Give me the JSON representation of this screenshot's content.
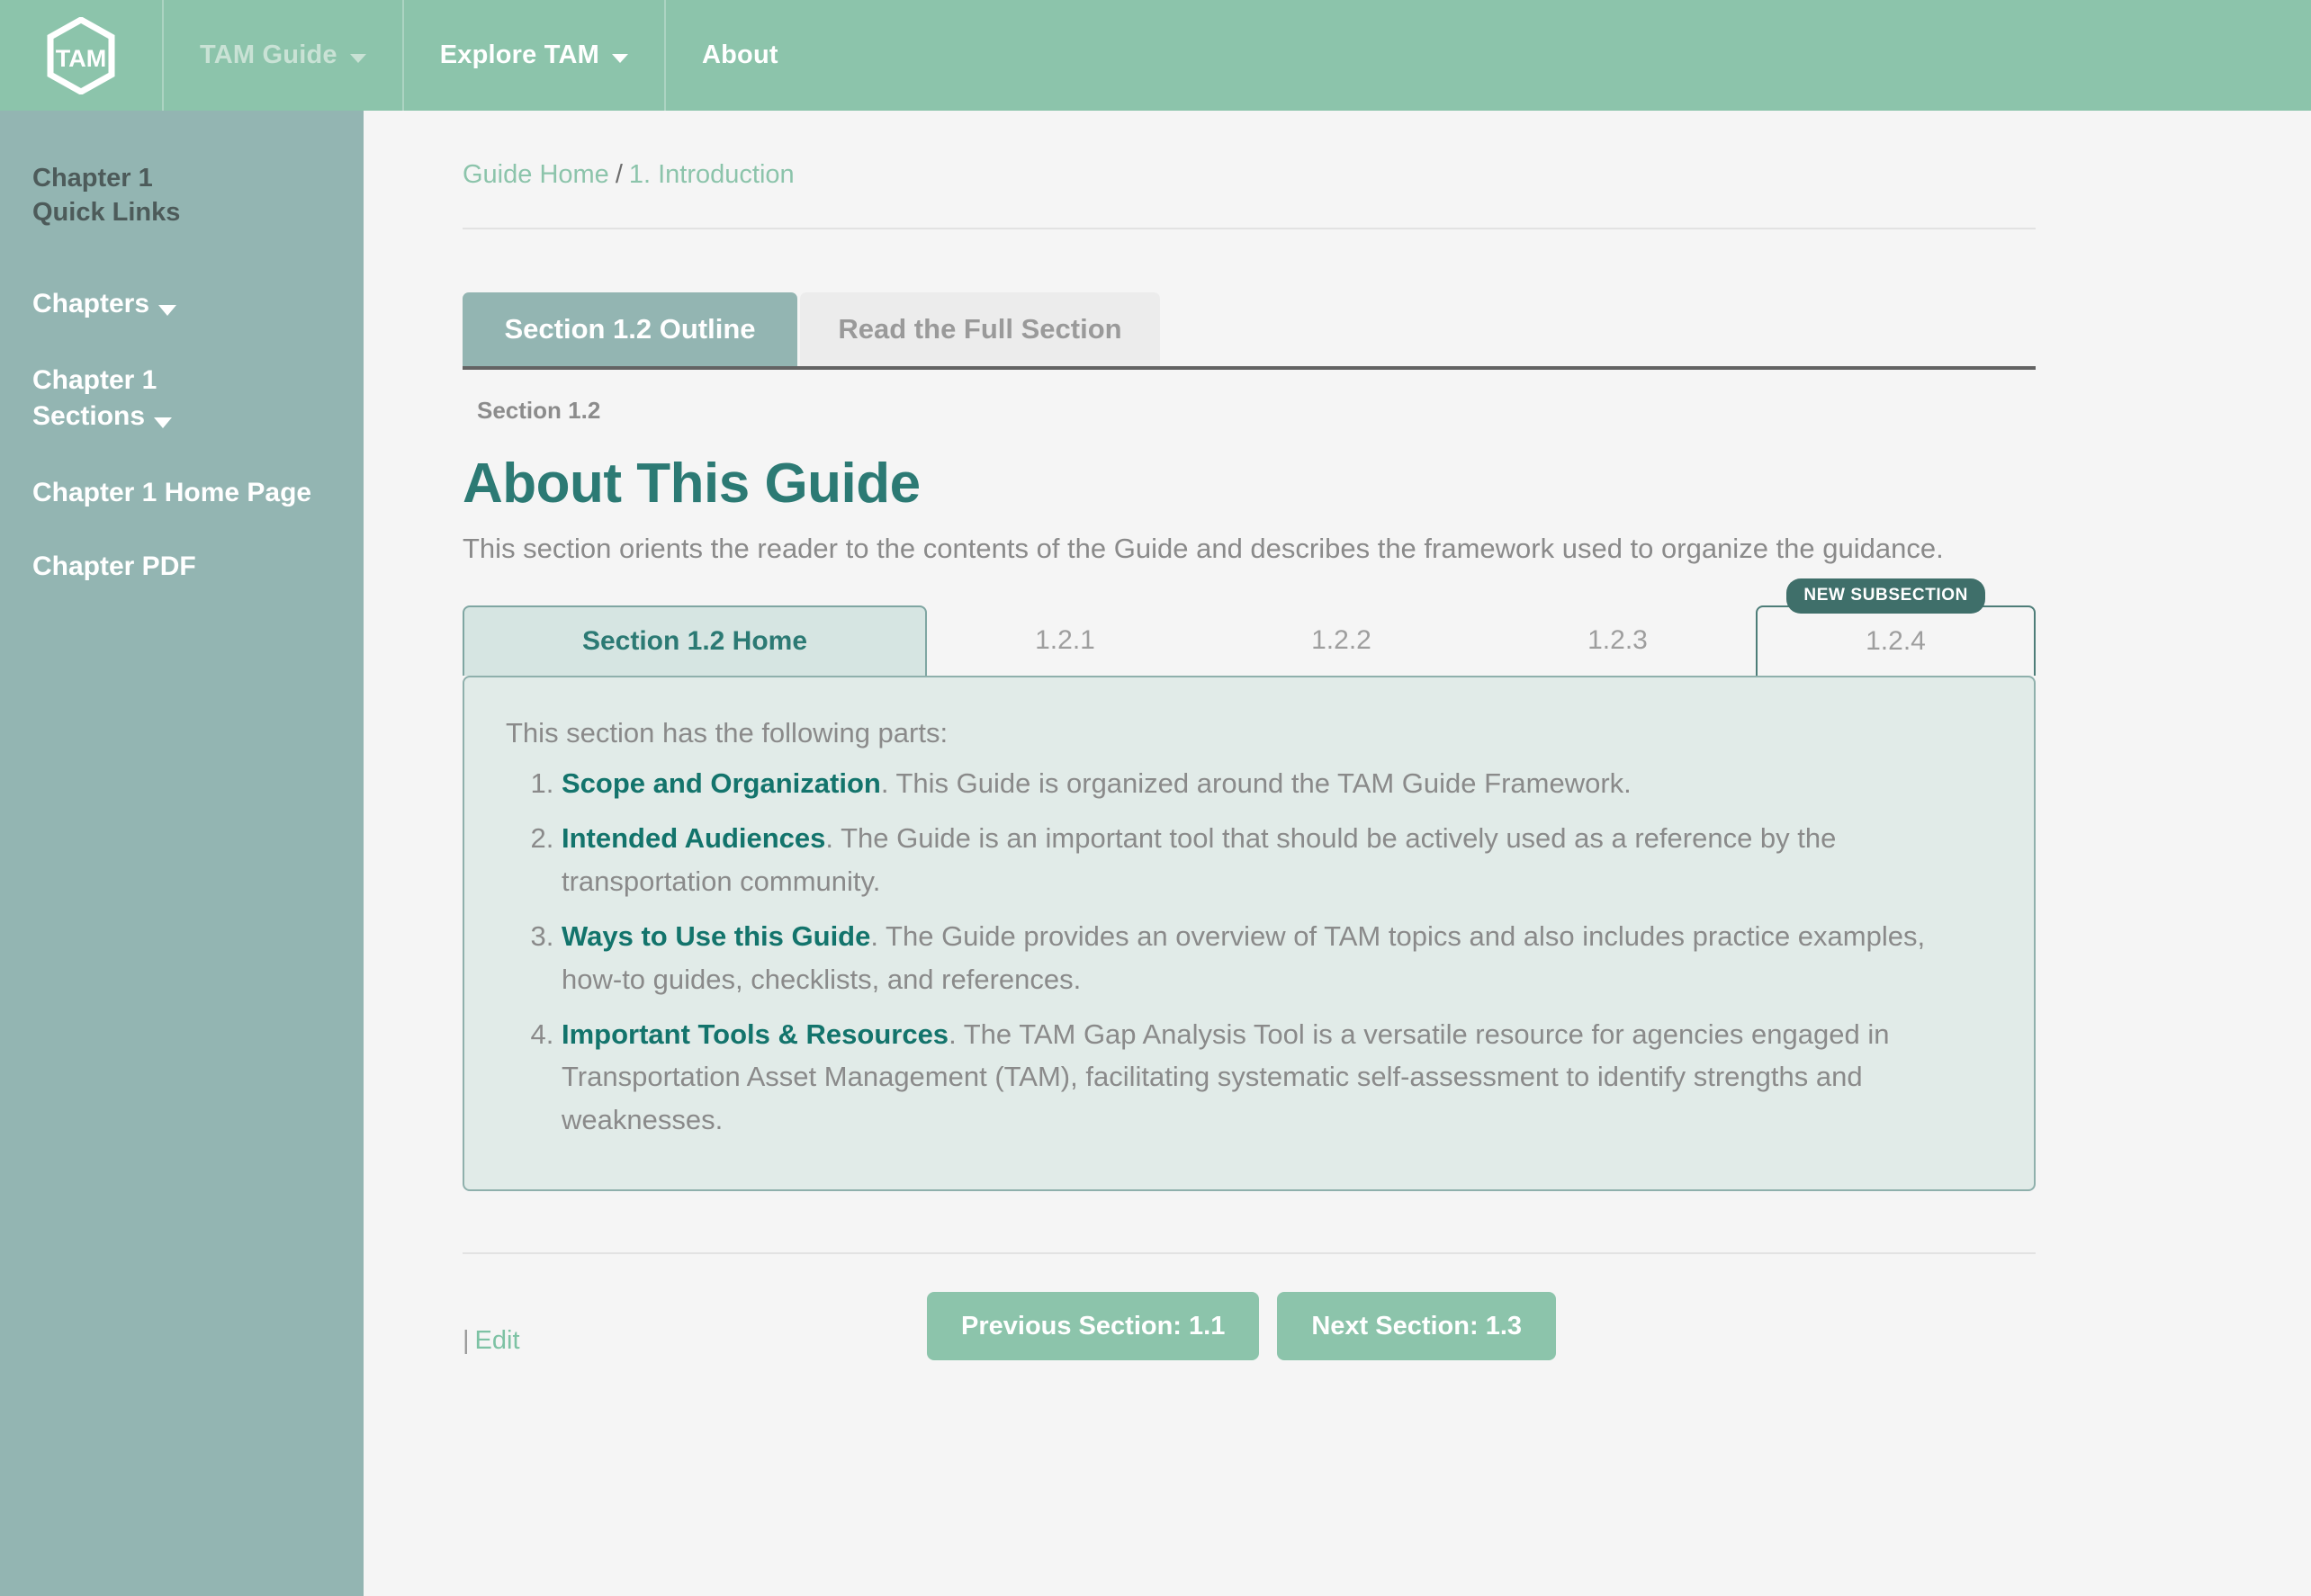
{
  "topnav": {
    "logo_text": "TAM",
    "items": [
      {
        "label": "TAM Guide",
        "has_caret": true,
        "state": "muted"
      },
      {
        "label": "Explore TAM",
        "has_caret": true,
        "state": "active"
      },
      {
        "label": "About",
        "has_caret": false,
        "state": "active"
      }
    ]
  },
  "sidebar": {
    "title_line1": "Chapter 1",
    "title_line2": "Quick Links",
    "chapters_label": "Chapters",
    "sections_line1": "Chapter 1",
    "sections_line2": "Sections",
    "home_page_label": "Chapter 1 Home Page",
    "pdf_label": "Chapter PDF"
  },
  "breadcrumb": {
    "home": "Guide Home",
    "separator": "/",
    "current": "1. Introduction"
  },
  "tabs": [
    {
      "label": "Section 1.2 Outline",
      "active": true
    },
    {
      "label": "Read the Full Section",
      "active": false
    }
  ],
  "heading": {
    "eyebrow": "Section 1.2",
    "title": "About This Guide",
    "lede": "This section orients the reader to the contents of the Guide and describes the framework used to organize the guidance."
  },
  "subtabs": {
    "badge": "NEW SUBSECTION",
    "items": [
      {
        "label": "Section 1.2 Home",
        "active": true,
        "outlined": false
      },
      {
        "label": "1.2.1",
        "active": false,
        "outlined": false
      },
      {
        "label": "1.2.2",
        "active": false,
        "outlined": false
      },
      {
        "label": "1.2.3",
        "active": false,
        "outlined": false
      },
      {
        "label": "1.2.4",
        "active": false,
        "outlined": true
      }
    ]
  },
  "panel": {
    "lead": "This section has the following parts:",
    "items": [
      {
        "term": "Scope and Organization",
        "text": ". This Guide is organized around the TAM Guide Framework."
      },
      {
        "term": "Intended Audiences",
        "text": ". The Guide is an important tool that should be actively used as a reference by the transportation community."
      },
      {
        "term": "Ways to Use this Guide",
        "text": ". The Guide provides an overview of TAM topics and also includes practice examples, how-to guides, checklists, and references."
      },
      {
        "term": "Important Tools & Resources",
        "text": ". The TAM Gap Analysis Tool is a versatile resource for agencies engaged in Transportation Asset Management (TAM), facilitating systematic self-assessment to identify strengths and weaknesses."
      }
    ]
  },
  "footer": {
    "edit_bar": "|",
    "edit_label": "Edit",
    "prev_label": "Previous Section: 1.1",
    "next_label": "Next Section: 1.3"
  },
  "colors": {
    "header_green": "#8cc4ab",
    "sidebar_teal": "#93b5b2",
    "title_teal": "#2c7a74",
    "panel_bg": "#e1ebe8",
    "badge_teal": "#3f6f6a",
    "muted_text": "#8a8a8a"
  }
}
